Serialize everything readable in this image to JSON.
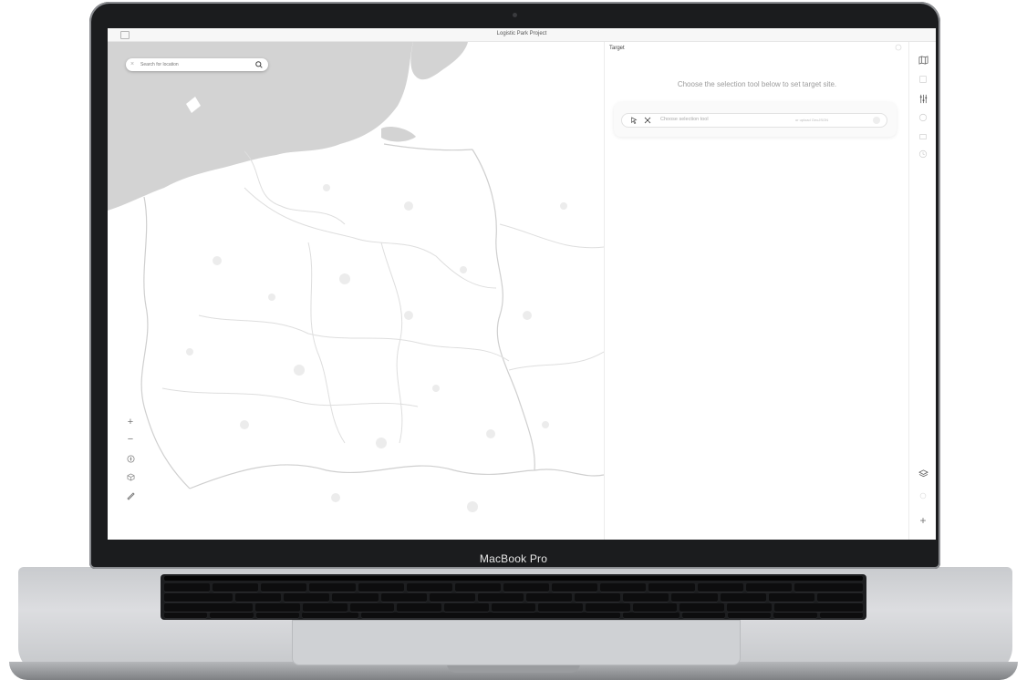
{
  "device": {
    "brand_label": "MacBook Pro"
  },
  "window": {
    "title": "Logistic Park Project"
  },
  "map": {
    "search": {
      "placeholder": "Search for location",
      "value": ""
    },
    "controls": [
      "plus-icon",
      "minus-icon",
      "compass-icon",
      "cube-icon",
      "ruler-icon"
    ],
    "colors": {
      "water": "#d3d3d3",
      "land": "#ffffff",
      "borders": "#cfcfcf"
    }
  },
  "panel": {
    "title": "Target",
    "help_text": "Choose the selection tool below to set target site.",
    "selector": {
      "placeholder": "Choose selection tool",
      "upload_hint": "or upload GeoJSON"
    }
  },
  "toolbar": {
    "top_icons": [
      "map-icon",
      "edit-icon",
      "sliders-icon",
      "globe-icon",
      "image-icon",
      "clock-icon"
    ],
    "bottom_icons": [
      "layers-icon",
      "settings-icon",
      "plus-icon"
    ]
  }
}
